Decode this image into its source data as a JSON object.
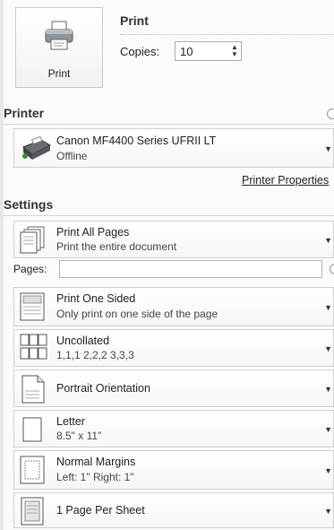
{
  "print": {
    "button_label": "Print",
    "title": "Print",
    "copies_label": "Copies:",
    "copies_value": "10"
  },
  "printer": {
    "section_title": "Printer",
    "name": "Canon MF4400 Series UFRII LT",
    "status": "Offline",
    "properties_link": "Printer Properties"
  },
  "settings": {
    "section_title": "Settings",
    "pages_label": "Pages:",
    "pages_value": "",
    "items": [
      {
        "title": "Print All Pages",
        "subtitle": "Print the entire document",
        "icon": "pages-icon"
      },
      {
        "title": "Print One Sided",
        "subtitle": "Only print on one side of the page",
        "icon": "one-sided-icon"
      },
      {
        "title": "Uncollated",
        "subtitle": "1,1,1   2,2,2   3,3,3",
        "icon": "uncollated-icon"
      },
      {
        "title": "Portrait Orientation",
        "subtitle": "",
        "icon": "portrait-icon"
      },
      {
        "title": "Letter",
        "subtitle": "8.5\" x 11\"",
        "icon": "letter-paper-icon"
      },
      {
        "title": "Normal Margins",
        "subtitle": "Left: 1\"   Right: 1\"",
        "icon": "margins-icon"
      },
      {
        "title": "1 Page Per Sheet",
        "subtitle": "",
        "icon": "pages-per-sheet-icon"
      }
    ]
  }
}
